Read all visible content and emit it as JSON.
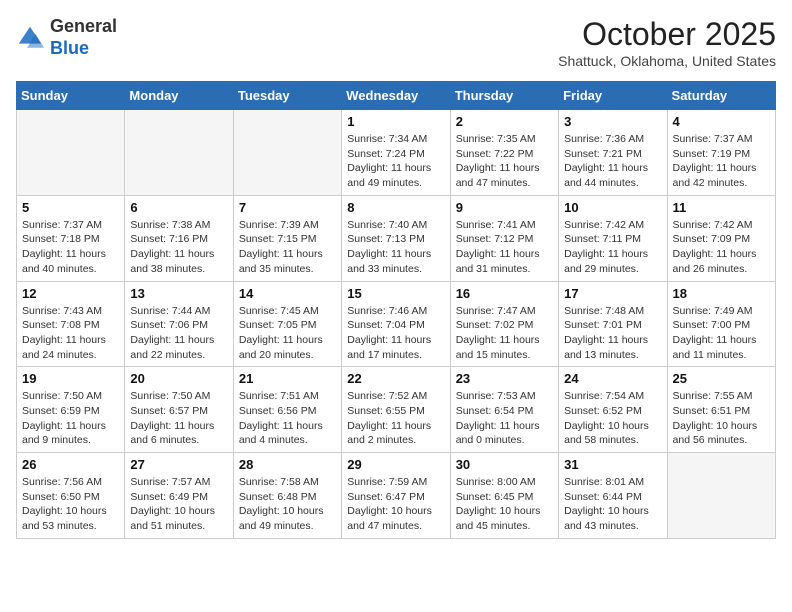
{
  "header": {
    "logo_general": "General",
    "logo_blue": "Blue",
    "month_title": "October 2025",
    "subtitle": "Shattuck, Oklahoma, United States"
  },
  "days_of_week": [
    "Sunday",
    "Monday",
    "Tuesday",
    "Wednesday",
    "Thursday",
    "Friday",
    "Saturday"
  ],
  "weeks": [
    [
      {
        "day": "",
        "content": ""
      },
      {
        "day": "",
        "content": ""
      },
      {
        "day": "",
        "content": ""
      },
      {
        "day": "1",
        "content": "Sunrise: 7:34 AM\nSunset: 7:24 PM\nDaylight: 11 hours and 49 minutes."
      },
      {
        "day": "2",
        "content": "Sunrise: 7:35 AM\nSunset: 7:22 PM\nDaylight: 11 hours and 47 minutes."
      },
      {
        "day": "3",
        "content": "Sunrise: 7:36 AM\nSunset: 7:21 PM\nDaylight: 11 hours and 44 minutes."
      },
      {
        "day": "4",
        "content": "Sunrise: 7:37 AM\nSunset: 7:19 PM\nDaylight: 11 hours and 42 minutes."
      }
    ],
    [
      {
        "day": "5",
        "content": "Sunrise: 7:37 AM\nSunset: 7:18 PM\nDaylight: 11 hours and 40 minutes."
      },
      {
        "day": "6",
        "content": "Sunrise: 7:38 AM\nSunset: 7:16 PM\nDaylight: 11 hours and 38 minutes."
      },
      {
        "day": "7",
        "content": "Sunrise: 7:39 AM\nSunset: 7:15 PM\nDaylight: 11 hours and 35 minutes."
      },
      {
        "day": "8",
        "content": "Sunrise: 7:40 AM\nSunset: 7:13 PM\nDaylight: 11 hours and 33 minutes."
      },
      {
        "day": "9",
        "content": "Sunrise: 7:41 AM\nSunset: 7:12 PM\nDaylight: 11 hours and 31 minutes."
      },
      {
        "day": "10",
        "content": "Sunrise: 7:42 AM\nSunset: 7:11 PM\nDaylight: 11 hours and 29 minutes."
      },
      {
        "day": "11",
        "content": "Sunrise: 7:42 AM\nSunset: 7:09 PM\nDaylight: 11 hours and 26 minutes."
      }
    ],
    [
      {
        "day": "12",
        "content": "Sunrise: 7:43 AM\nSunset: 7:08 PM\nDaylight: 11 hours and 24 minutes."
      },
      {
        "day": "13",
        "content": "Sunrise: 7:44 AM\nSunset: 7:06 PM\nDaylight: 11 hours and 22 minutes."
      },
      {
        "day": "14",
        "content": "Sunrise: 7:45 AM\nSunset: 7:05 PM\nDaylight: 11 hours and 20 minutes."
      },
      {
        "day": "15",
        "content": "Sunrise: 7:46 AM\nSunset: 7:04 PM\nDaylight: 11 hours and 17 minutes."
      },
      {
        "day": "16",
        "content": "Sunrise: 7:47 AM\nSunset: 7:02 PM\nDaylight: 11 hours and 15 minutes."
      },
      {
        "day": "17",
        "content": "Sunrise: 7:48 AM\nSunset: 7:01 PM\nDaylight: 11 hours and 13 minutes."
      },
      {
        "day": "18",
        "content": "Sunrise: 7:49 AM\nSunset: 7:00 PM\nDaylight: 11 hours and 11 minutes."
      }
    ],
    [
      {
        "day": "19",
        "content": "Sunrise: 7:50 AM\nSunset: 6:59 PM\nDaylight: 11 hours and 9 minutes."
      },
      {
        "day": "20",
        "content": "Sunrise: 7:50 AM\nSunset: 6:57 PM\nDaylight: 11 hours and 6 minutes."
      },
      {
        "day": "21",
        "content": "Sunrise: 7:51 AM\nSunset: 6:56 PM\nDaylight: 11 hours and 4 minutes."
      },
      {
        "day": "22",
        "content": "Sunrise: 7:52 AM\nSunset: 6:55 PM\nDaylight: 11 hours and 2 minutes."
      },
      {
        "day": "23",
        "content": "Sunrise: 7:53 AM\nSunset: 6:54 PM\nDaylight: 11 hours and 0 minutes."
      },
      {
        "day": "24",
        "content": "Sunrise: 7:54 AM\nSunset: 6:52 PM\nDaylight: 10 hours and 58 minutes."
      },
      {
        "day": "25",
        "content": "Sunrise: 7:55 AM\nSunset: 6:51 PM\nDaylight: 10 hours and 56 minutes."
      }
    ],
    [
      {
        "day": "26",
        "content": "Sunrise: 7:56 AM\nSunset: 6:50 PM\nDaylight: 10 hours and 53 minutes."
      },
      {
        "day": "27",
        "content": "Sunrise: 7:57 AM\nSunset: 6:49 PM\nDaylight: 10 hours and 51 minutes."
      },
      {
        "day": "28",
        "content": "Sunrise: 7:58 AM\nSunset: 6:48 PM\nDaylight: 10 hours and 49 minutes."
      },
      {
        "day": "29",
        "content": "Sunrise: 7:59 AM\nSunset: 6:47 PM\nDaylight: 10 hours and 47 minutes."
      },
      {
        "day": "30",
        "content": "Sunrise: 8:00 AM\nSunset: 6:45 PM\nDaylight: 10 hours and 45 minutes."
      },
      {
        "day": "31",
        "content": "Sunrise: 8:01 AM\nSunset: 6:44 PM\nDaylight: 10 hours and 43 minutes."
      },
      {
        "day": "",
        "content": ""
      }
    ]
  ]
}
